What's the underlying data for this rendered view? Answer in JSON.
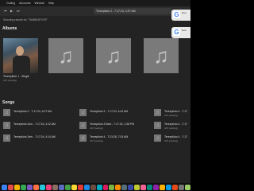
{
  "menubar": {
    "apple": "",
    "items": [
      "Coding",
      "Accounts",
      "Window",
      "Help"
    ]
  },
  "toolbar": {
    "prev": "⏮",
    "play": "▶",
    "next": "⏭",
    "now_playing": "Tenrepiloto 2 - 7:17:24, 4:07 AM"
  },
  "search": {
    "text": "Showing results for \"TAMBEDITOR\""
  },
  "albums": {
    "heading": "Albums",
    "first_title": "Tenrepiloto 1 - Single",
    "first_sub": "Ah!! (setting)"
  },
  "songs": {
    "heading": "Songs",
    "items": [
      {
        "title": "Tenrepiloto 2 - 7:17:24, 4:07 AM",
        "sub": ""
      },
      {
        "title": "Tenrepiloto 3 - 7:17:24, 4:42 AM",
        "sub": ""
      },
      {
        "title": "Tenrepiloto 4 - 7:17",
        "sub": "Ah!! (setting)"
      },
      {
        "title": "Tenrepiloto 2em - 7:17:24, 4:12 AM",
        "sub": ""
      },
      {
        "title": "Tenrepiloto 3 Best - 7:17:24, 1:38 PM",
        "sub": "Ah!! (setting)"
      },
      {
        "title": "Tenrepiloto 4 - 7:17",
        "sub": "Ah!! (setting)"
      },
      {
        "title": "Tenrepiloto 2em - 7:17:24, 4:14 AM",
        "sub": ""
      },
      {
        "title": "Tenrepiloto 4 - 7:23:28, 7:03 AM",
        "sub": "Ah!! (setting)"
      },
      {
        "title": "Tenrepiloto 4 - 7:17",
        "sub": "Ah!! (setting)"
      }
    ]
  },
  "notifications": [
    {
      "icon": "G",
      "text": "Goo"
    },
    {
      "icon": "G",
      "text": "Goo"
    }
  ],
  "dock": {
    "colors": [
      "#3b82f6",
      "#e54b4b",
      "#f4b400",
      "#34a853",
      "#7e57c2",
      "#ff7043",
      "#26c6da",
      "#ec407a",
      "#8d6e63",
      "#5c6bc0",
      "#43a047",
      "#fdd835",
      "#e53935",
      "#1e88e5",
      "#6d4c41",
      "#00acc1",
      "#d81b60",
      "#7cb342",
      "#fb8c00",
      "#546e7a",
      "#3949ab",
      "#c0ca33",
      "#f06292",
      "#00897b",
      "#8e24aa",
      "#ffb300",
      "#039be5",
      "#e64a19",
      "#757575",
      "#9ccc65"
    ]
  }
}
